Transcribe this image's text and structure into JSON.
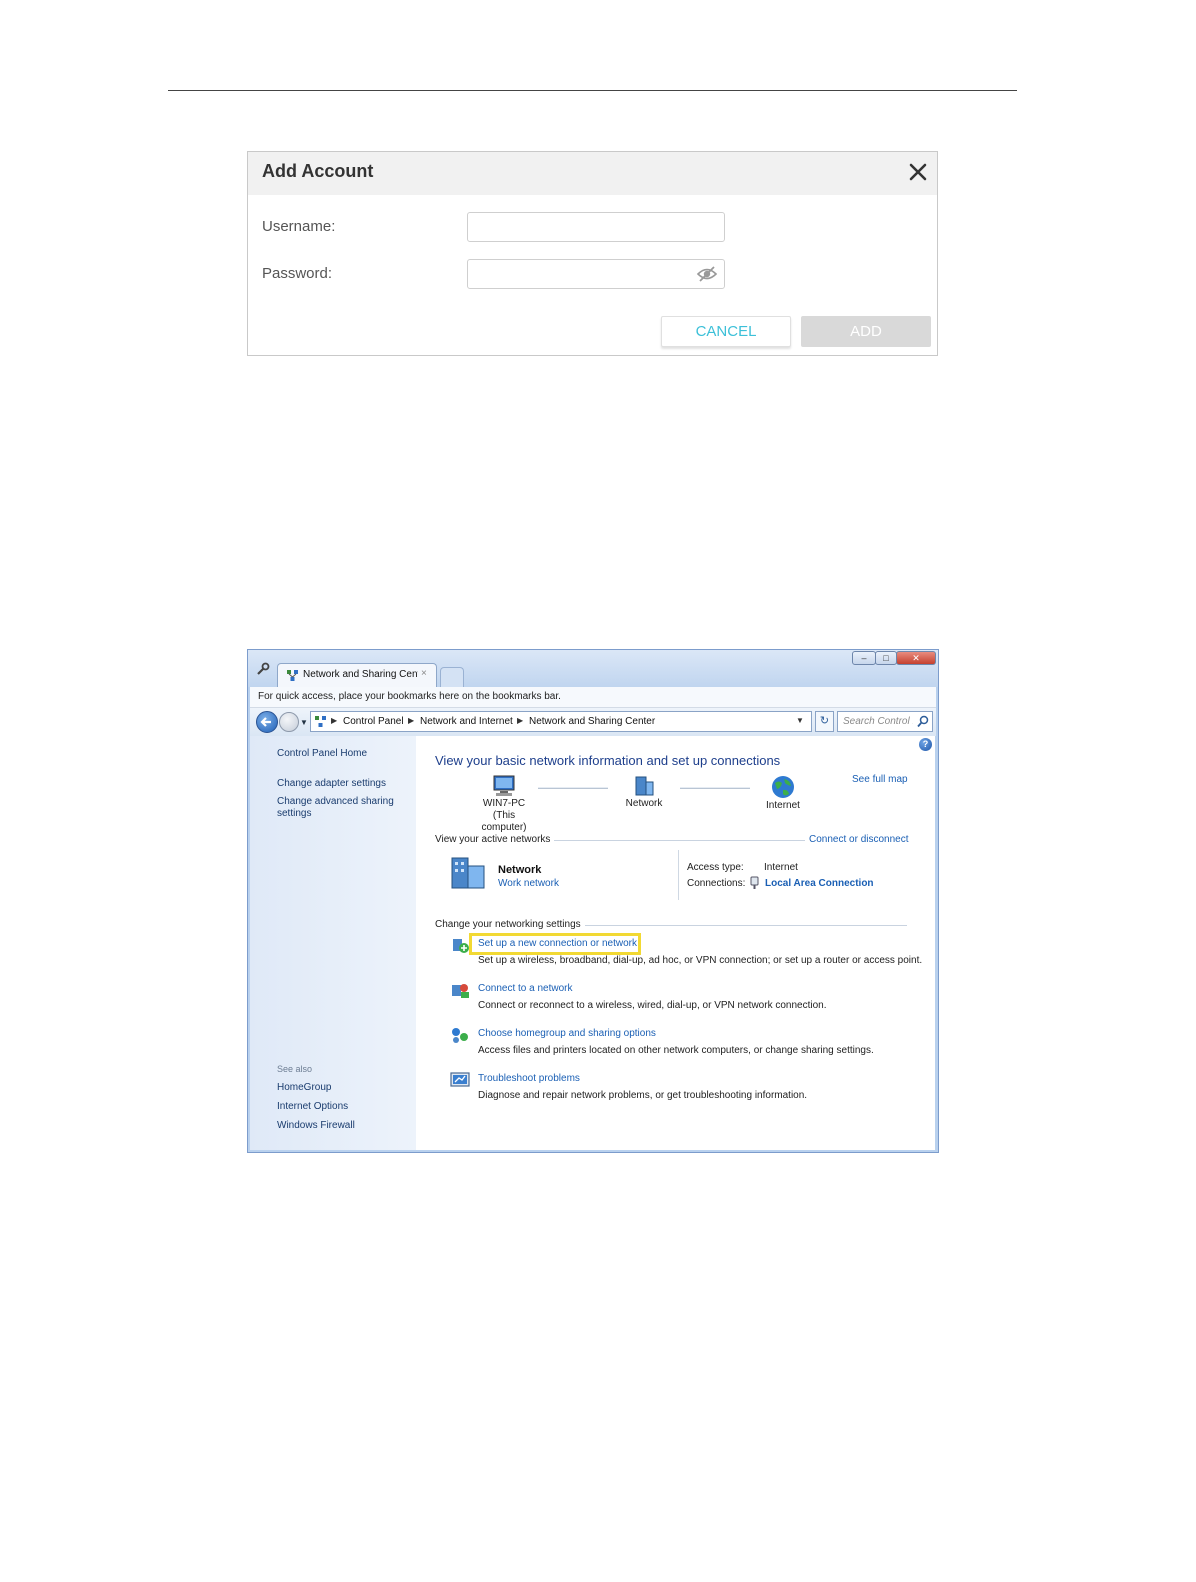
{
  "add_account": {
    "title": "Add Account",
    "username_label": "Username:",
    "username_value": "",
    "password_label": "Password:",
    "password_value": "",
    "cancel_label": "CANCEL",
    "add_label": "ADD",
    "colors": {
      "cancel_text": "#3cc0d8",
      "add_disabled": "#d9d9d9"
    }
  },
  "browser": {
    "tab_label": "Network and Sharing Center",
    "tab_close": "×",
    "bookmarks_hint": "For quick access, place your bookmarks here on the bookmarks bar.",
    "breadcrumb": [
      "Control Panel",
      "Network and Internet",
      "Network and Sharing Center"
    ],
    "search_placeholder": "Search Control Panel",
    "caption_buttons": [
      "–",
      "□",
      "✕"
    ]
  },
  "sidebar": {
    "home": "Control Panel Home",
    "links": [
      "Change adapter settings",
      "Change advanced sharing",
      "settings"
    ],
    "see_also_title": "See also",
    "see_also": [
      "HomeGroup",
      "Internet Options",
      "Windows Firewall"
    ]
  },
  "main": {
    "title": "View your basic network information and set up connections",
    "see_full_map": "See full map",
    "map_nodes": [
      {
        "name": "WIN7-PC",
        "sub": "(This computer)"
      },
      {
        "name": "Network",
        "sub": ""
      },
      {
        "name": "Internet",
        "sub": ""
      }
    ],
    "active_networks_label": "View your active networks",
    "connect_disconnect": "Connect or disconnect",
    "network_name": "Network",
    "network_type": "Work network",
    "access_type_label": "Access type:",
    "access_type_value": "Internet",
    "connections_label": "Connections:",
    "connections_value": "Local Area Connection",
    "change_settings_label": "Change your networking settings",
    "tasks": [
      {
        "title": "Set up a new connection or network",
        "desc": "Set up a wireless, broadband, dial-up, ad hoc, or VPN connection; or set up a router or access point."
      },
      {
        "title": "Connect to a network",
        "desc": "Connect or reconnect to a wireless, wired, dial-up, or VPN network connection."
      },
      {
        "title": "Choose homegroup and sharing options",
        "desc": "Access files and printers located on other network computers, or change sharing settings."
      },
      {
        "title": "Troubleshoot problems",
        "desc": "Diagnose and repair network problems, or get troubleshooting information."
      }
    ],
    "highlight_color": "#f2d933"
  }
}
